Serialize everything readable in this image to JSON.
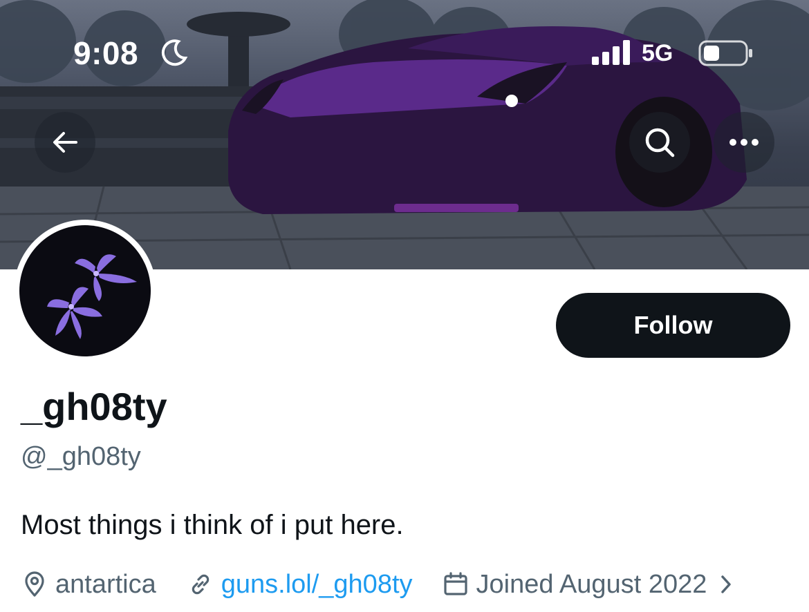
{
  "status_bar": {
    "time": "9:08",
    "network": "5G",
    "icons": [
      "moon-icon",
      "signal-icon",
      "battery-icon"
    ]
  },
  "nav": {
    "icons": [
      "back-arrow-icon",
      "search-icon",
      "more-icon"
    ]
  },
  "profile": {
    "display_name": "_gh08ty",
    "handle": "@_gh08ty",
    "bio": "Most things i think of i put here.",
    "follow_label": "Follow",
    "location": "antartica",
    "link": "guns.lol/_gh08ty",
    "joined": "Joined August 2022"
  },
  "colors": {
    "follow_bg": "#0f1419",
    "link": "#1d9bf0",
    "secondary_text": "#536471",
    "car_accent": "#5a2a8a"
  }
}
